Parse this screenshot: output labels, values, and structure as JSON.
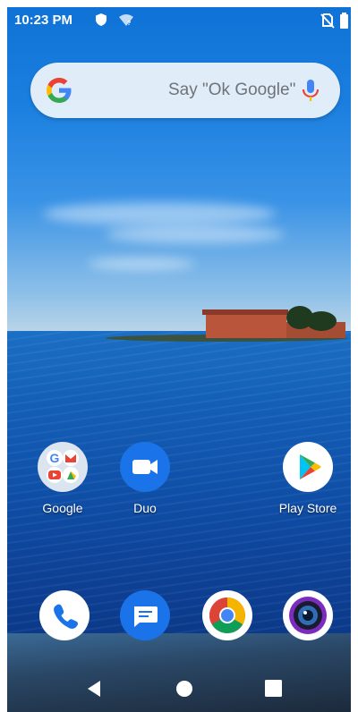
{
  "status_bar": {
    "time": "10:23 PM",
    "icons": [
      "shield-icon",
      "wifi-question-icon",
      "no-sim-icon",
      "battery-icon"
    ]
  },
  "search": {
    "placeholder": "Say \"Ok Google\"",
    "icons": [
      "google-g-icon",
      "microphone-icon"
    ]
  },
  "home_apps": [
    {
      "label": "Google",
      "icon": "google-folder-icon"
    },
    {
      "label": "Duo",
      "icon": "duo-video-icon"
    },
    {
      "label": "Play Store",
      "icon": "play-store-icon"
    }
  ],
  "dock": [
    {
      "icon": "phone-icon"
    },
    {
      "icon": "messages-icon"
    },
    {
      "icon": "chrome-icon"
    },
    {
      "icon": "camera-icon"
    }
  ],
  "nav_bar": {
    "buttons": [
      "back-icon",
      "home-icon",
      "recents-icon"
    ]
  },
  "colors": {
    "google_blue": "#4285F4",
    "google_red": "#EA4335",
    "google_yellow": "#FBBC05",
    "google_green": "#34A853",
    "duo_blue": "#1a73e8"
  }
}
